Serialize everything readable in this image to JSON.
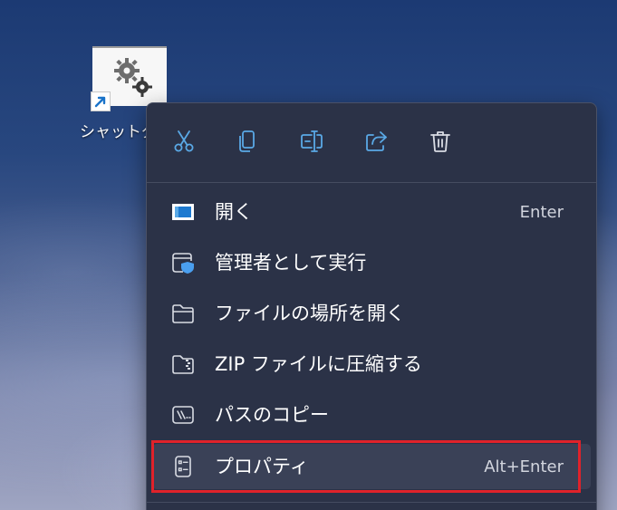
{
  "desktop": {
    "shortcut_label": "シャットダウン",
    "shortcut_icon": "gears-icon",
    "shortcut_badge": "shortcut-arrow-icon"
  },
  "context_menu": {
    "toolbar": [
      {
        "name": "cut",
        "icon": "scissors-icon"
      },
      {
        "name": "copy",
        "icon": "copy-icon"
      },
      {
        "name": "rename",
        "icon": "rename-icon"
      },
      {
        "name": "share",
        "icon": "share-icon"
      },
      {
        "name": "delete",
        "icon": "trash-icon"
      }
    ],
    "items": [
      {
        "label": "開く",
        "shortcut": "Enter",
        "icon": "open-window-icon"
      },
      {
        "label": "管理者として実行",
        "shortcut": "",
        "icon": "shield-window-icon"
      },
      {
        "label": "ファイルの場所を開く",
        "shortcut": "",
        "icon": "folder-icon"
      },
      {
        "label": "ZIP ファイルに圧縮する",
        "shortcut": "",
        "icon": "zip-folder-icon"
      },
      {
        "label": "パスのコピー",
        "shortcut": "",
        "icon": "path-copy-icon"
      },
      {
        "label": "プロパティ",
        "shortcut": "Alt+Enter",
        "icon": "properties-icon"
      }
    ]
  },
  "colors": {
    "menu_bg": "#2b3247",
    "accent_blue": "#5aa9e6",
    "highlight_red": "#e0222a"
  }
}
